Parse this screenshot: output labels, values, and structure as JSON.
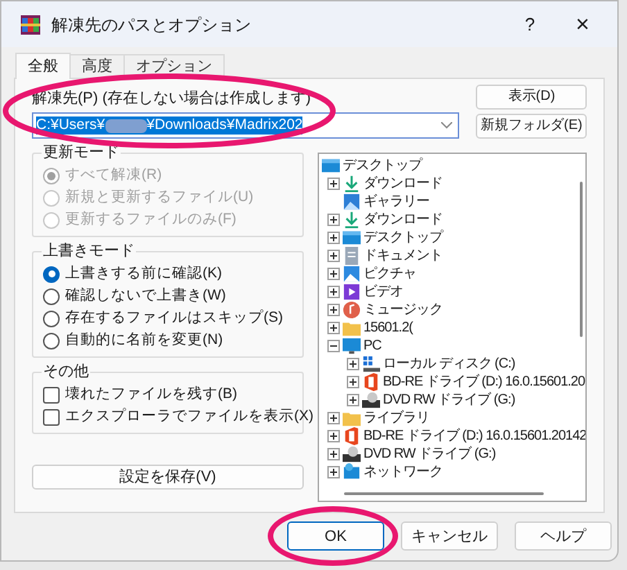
{
  "window": {
    "title": "解凍先のパスとオプション",
    "help": "?",
    "close": "×"
  },
  "tabs": [
    {
      "label": "全般",
      "selected": true
    },
    {
      "label": "高度",
      "selected": false
    },
    {
      "label": "オプション",
      "selected": false
    }
  ],
  "destination": {
    "label": "解凍先(P) (存在しない場合は作成します)",
    "value_before": "C:¥Users¥",
    "redacted": true,
    "value_after": "¥Downloads¥Madrix202",
    "highlighted": true
  },
  "side_buttons": [
    "表示(D)",
    "新規フォルダ(E)"
  ],
  "groups": [
    {
      "title": "更新モード",
      "kind": "radio",
      "disabled": true,
      "items": [
        {
          "label": "すべて解凍(R)",
          "selected": true
        },
        {
          "label": "新規と更新するファイル(U)",
          "selected": false
        },
        {
          "label": "更新するファイルのみ(F)",
          "selected": false
        }
      ]
    },
    {
      "title": "上書きモード",
      "kind": "radio",
      "disabled": false,
      "items": [
        {
          "label": "上書きする前に確認(K)",
          "selected": true
        },
        {
          "label": "確認しないで上書き(W)",
          "selected": false
        },
        {
          "label": "存在するファイルはスキップ(S)",
          "selected": false
        },
        {
          "label": "自動的に名前を変更(N)",
          "selected": false
        }
      ]
    },
    {
      "title": "その他",
      "kind": "checkbox",
      "disabled": false,
      "items": [
        {
          "label": "壊れたファイルを残す(B)",
          "checked": false
        },
        {
          "label": "エクスプローラでファイルを表示(X)",
          "checked": false
        }
      ]
    }
  ],
  "save_button": "設定を保存(V)",
  "tree": {
    "label": "デスクトップ",
    "kind": "desktop",
    "children": [
      {
        "label": "ダウンロード",
        "kind": "download",
        "expandable": true,
        "expanded": false
      },
      {
        "label": "ギャラリー",
        "kind": "gallery",
        "expandable": false
      },
      {
        "label": "ダウンロード",
        "kind": "download",
        "expandable": true,
        "expanded": false
      },
      {
        "label": "デスクトップ",
        "kind": "desktop",
        "expandable": true,
        "expanded": false
      },
      {
        "label": "ドキュメント",
        "kind": "document",
        "expandable": true,
        "expanded": false
      },
      {
        "label": "ピクチャ",
        "kind": "pictures",
        "expandable": true,
        "expanded": false
      },
      {
        "label": "ビデオ",
        "kind": "video",
        "expandable": true,
        "expanded": false
      },
      {
        "label": "ミュージック",
        "kind": "music",
        "expandable": true,
        "expanded": false
      },
      {
        "label": "15601.2(",
        "kind": "folder",
        "expandable": true,
        "expanded": false
      },
      {
        "label": "PC",
        "kind": "pc",
        "expandable": true,
        "expanded": true,
        "children": [
          {
            "label": "ローカル ディスク (C:)",
            "kind": "disk",
            "expandable": true,
            "expanded": false
          },
          {
            "label": "BD-RE ドライブ (D:) 16.0.15601.20",
            "kind": "office",
            "expandable": true,
            "expanded": false
          },
          {
            "label": "DVD RW ドライブ (G:)",
            "kind": "dvd",
            "expandable": true,
            "expanded": false
          }
        ]
      },
      {
        "label": "ライブラリ",
        "kind": "folder",
        "expandable": true,
        "expanded": false
      },
      {
        "label": "BD-RE ドライブ (D:) 16.0.15601.20142",
        "kind": "office",
        "expandable": true,
        "expanded": false
      },
      {
        "label": "DVD RW ドライブ (G:)",
        "kind": "dvd",
        "expandable": true,
        "expanded": false
      },
      {
        "label": "ネットワーク",
        "kind": "network",
        "expandable": true,
        "expanded": false
      }
    ]
  },
  "buttons": [
    {
      "label": "OK",
      "default": true,
      "highlighted": true
    },
    {
      "label": "キャンセル",
      "default": false
    },
    {
      "label": "ヘルプ",
      "default": false
    }
  ]
}
